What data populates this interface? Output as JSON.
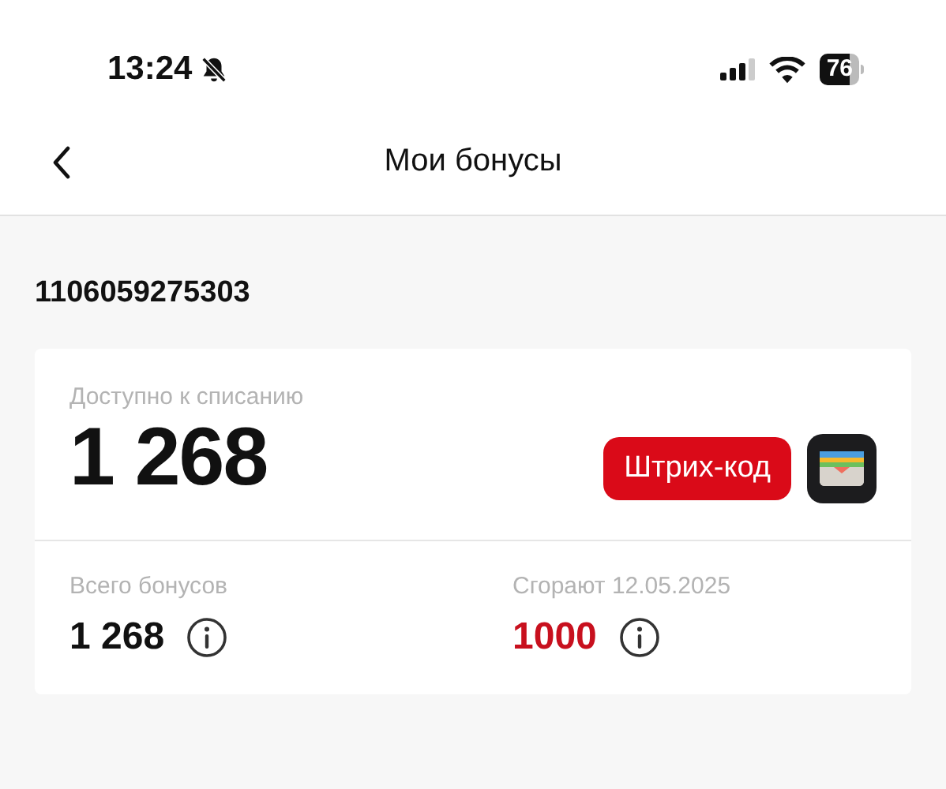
{
  "status_bar": {
    "time": "13:24",
    "silent": true,
    "battery": "76"
  },
  "nav": {
    "title": "Мои бонусы"
  },
  "account_number": "1106059275303",
  "card": {
    "available_label": "Доступно к списанию",
    "available_value": "1 268",
    "barcode_button": "Штрих-код",
    "stats": [
      {
        "label": "Всего бонусов",
        "value": "1 268",
        "highlight": false
      },
      {
        "label": "Сгорают 12.05.2025",
        "value": "1000",
        "highlight": true
      }
    ]
  }
}
